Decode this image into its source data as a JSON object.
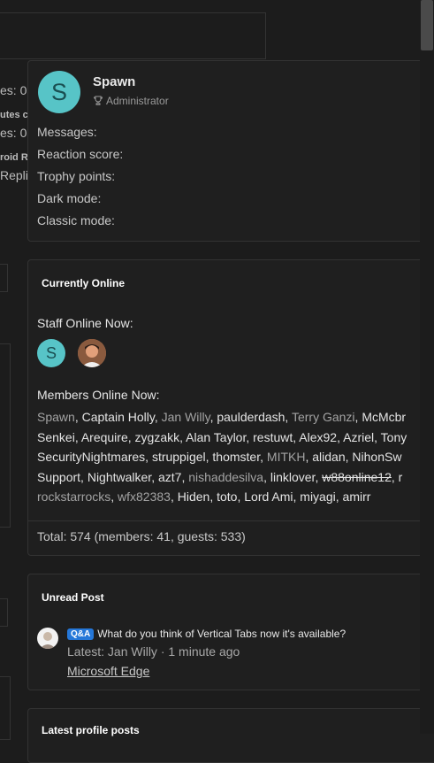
{
  "background": {
    "left_fragments": [
      "es: 0",
      "utes c",
      "es: 0",
      "roid R",
      "Replie"
    ]
  },
  "profile_card": {
    "avatar_letter": "S",
    "name": "Spawn",
    "role": "Administrator",
    "stats": [
      "Messages:",
      "Reaction score:",
      "Trophy points:",
      "Dark mode:",
      "Classic mode:"
    ]
  },
  "online_panel": {
    "title": "Currently Online",
    "staff_heading": "Staff Online Now:",
    "staff_avatar_letter": "S",
    "members_heading": "Members Online Now:",
    "member_lines": [
      [
        {
          "name": "Spawn",
          "style": "staff"
        },
        {
          "sep": ", "
        },
        {
          "name": "Captain Holly",
          "style": "normal"
        },
        {
          "sep": ", "
        },
        {
          "name": "Jan Willy",
          "style": "staff"
        },
        {
          "sep": ", "
        },
        {
          "name": "paulderdash",
          "style": "normal"
        },
        {
          "sep": ", "
        },
        {
          "name": "Terry Ganzi",
          "style": "staff"
        },
        {
          "sep": ", "
        },
        {
          "name": "McMcbr",
          "style": "normal"
        }
      ],
      [
        {
          "name": "Senkei",
          "style": "normal"
        },
        {
          "sep": ", "
        },
        {
          "name": "Arequire",
          "style": "normal"
        },
        {
          "sep": ", "
        },
        {
          "name": "zygzakk",
          "style": "normal"
        },
        {
          "sep": ", "
        },
        {
          "name": "Alan Taylor",
          "style": "normal"
        },
        {
          "sep": ", "
        },
        {
          "name": "restuwt",
          "style": "normal"
        },
        {
          "sep": ", "
        },
        {
          "name": "Alex92",
          "style": "normal"
        },
        {
          "sep": ", "
        },
        {
          "name": "Azriel",
          "style": "normal"
        },
        {
          "sep": ", "
        },
        {
          "name": "Tony",
          "style": "normal"
        }
      ],
      [
        {
          "name": "SecurityNightmares",
          "style": "normal"
        },
        {
          "sep": ", "
        },
        {
          "name": "struppigel",
          "style": "normal"
        },
        {
          "sep": ", "
        },
        {
          "name": "thomster",
          "style": "normal"
        },
        {
          "sep": ", "
        },
        {
          "name": "MITKH",
          "style": "staff"
        },
        {
          "sep": ", "
        },
        {
          "name": "alidan",
          "style": "normal"
        },
        {
          "sep": ", "
        },
        {
          "name": "NihonSw",
          "style": "normal"
        }
      ],
      [
        {
          "name": "Support",
          "style": "normal"
        },
        {
          "sep": ", "
        },
        {
          "name": "Nightwalker",
          "style": "normal"
        },
        {
          "sep": ", "
        },
        {
          "name": "azt7",
          "style": "normal"
        },
        {
          "sep": ", "
        },
        {
          "name": "nishaddesilva",
          "style": "staff"
        },
        {
          "sep": ", "
        },
        {
          "name": "linklover",
          "style": "normal"
        },
        {
          "sep": ", "
        },
        {
          "name": "w88online12",
          "style": "banned"
        },
        {
          "sep": ", r"
        }
      ],
      [
        {
          "name": "rockstarrocks",
          "style": "staff"
        },
        {
          "sep": ", "
        },
        {
          "name": "wfx82383",
          "style": "staff"
        },
        {
          "sep": ", "
        },
        {
          "name": "Hiden",
          "style": "normal"
        },
        {
          "sep": ", "
        },
        {
          "name": "toto",
          "style": "normal"
        },
        {
          "sep": ", "
        },
        {
          "name": "Lord Ami",
          "style": "normal"
        },
        {
          "sep": ", "
        },
        {
          "name": "miyagi",
          "style": "normal"
        },
        {
          "sep": ", "
        },
        {
          "name": "amirr",
          "style": "normal"
        }
      ]
    ],
    "total": "Total: 574 (members: 41, guests: 533)"
  },
  "unread_panel": {
    "title": "Unread Post",
    "badge": "Q&A",
    "thread_title": "What do you think of Vertical Tabs now it's available?",
    "latest": "Latest: Jan Willy · 1 minute ago",
    "forum": "Microsoft Edge"
  },
  "latest_panel": {
    "title": "Latest profile posts"
  }
}
